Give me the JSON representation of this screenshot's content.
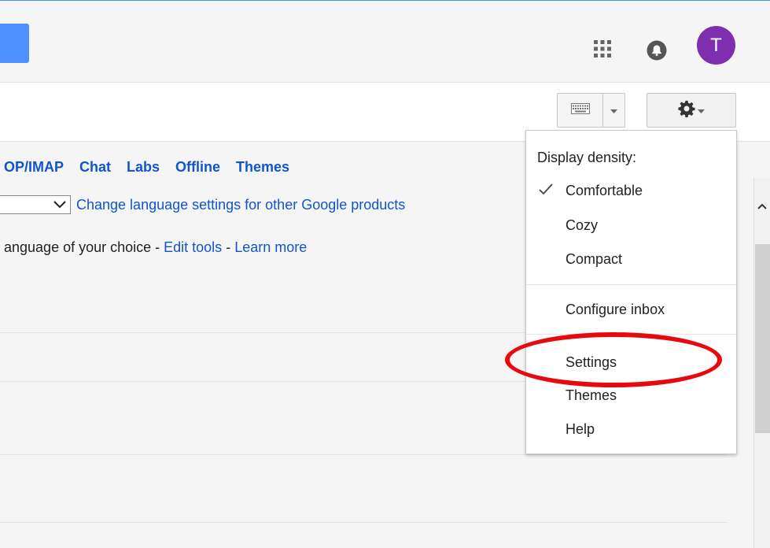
{
  "header": {
    "avatar_letter": "T"
  },
  "settings_tabs": [
    "OP/IMAP",
    "Chat",
    "Labs",
    "Offline",
    "Themes"
  ],
  "language": {
    "link": "Change language settings for other Google products"
  },
  "input_tools": {
    "prefix": "anguage of your choice - ",
    "edit_link": "Edit tools",
    "separator": " - ",
    "learn_link": "Learn more"
  },
  "gear_menu": {
    "density_header": "Display density:",
    "density_options": [
      "Comfortable",
      "Cozy",
      "Compact"
    ],
    "selected_density": "Comfortable",
    "configure_inbox": "Configure inbox",
    "settings": "Settings",
    "themes": "Themes",
    "help": "Help"
  },
  "colors": {
    "accent_blue": "#4d90fe",
    "link_blue": "#1155cc",
    "avatar_purple": "#7d2fae",
    "highlight_red": "#e8090e"
  },
  "icons": {
    "apps": "apps-grid-icon",
    "notifications": "bell-icon",
    "keyboard": "keyboard-icon",
    "gear": "gear-icon",
    "check": "check-icon",
    "scroll_up": "chevron-up-icon"
  }
}
